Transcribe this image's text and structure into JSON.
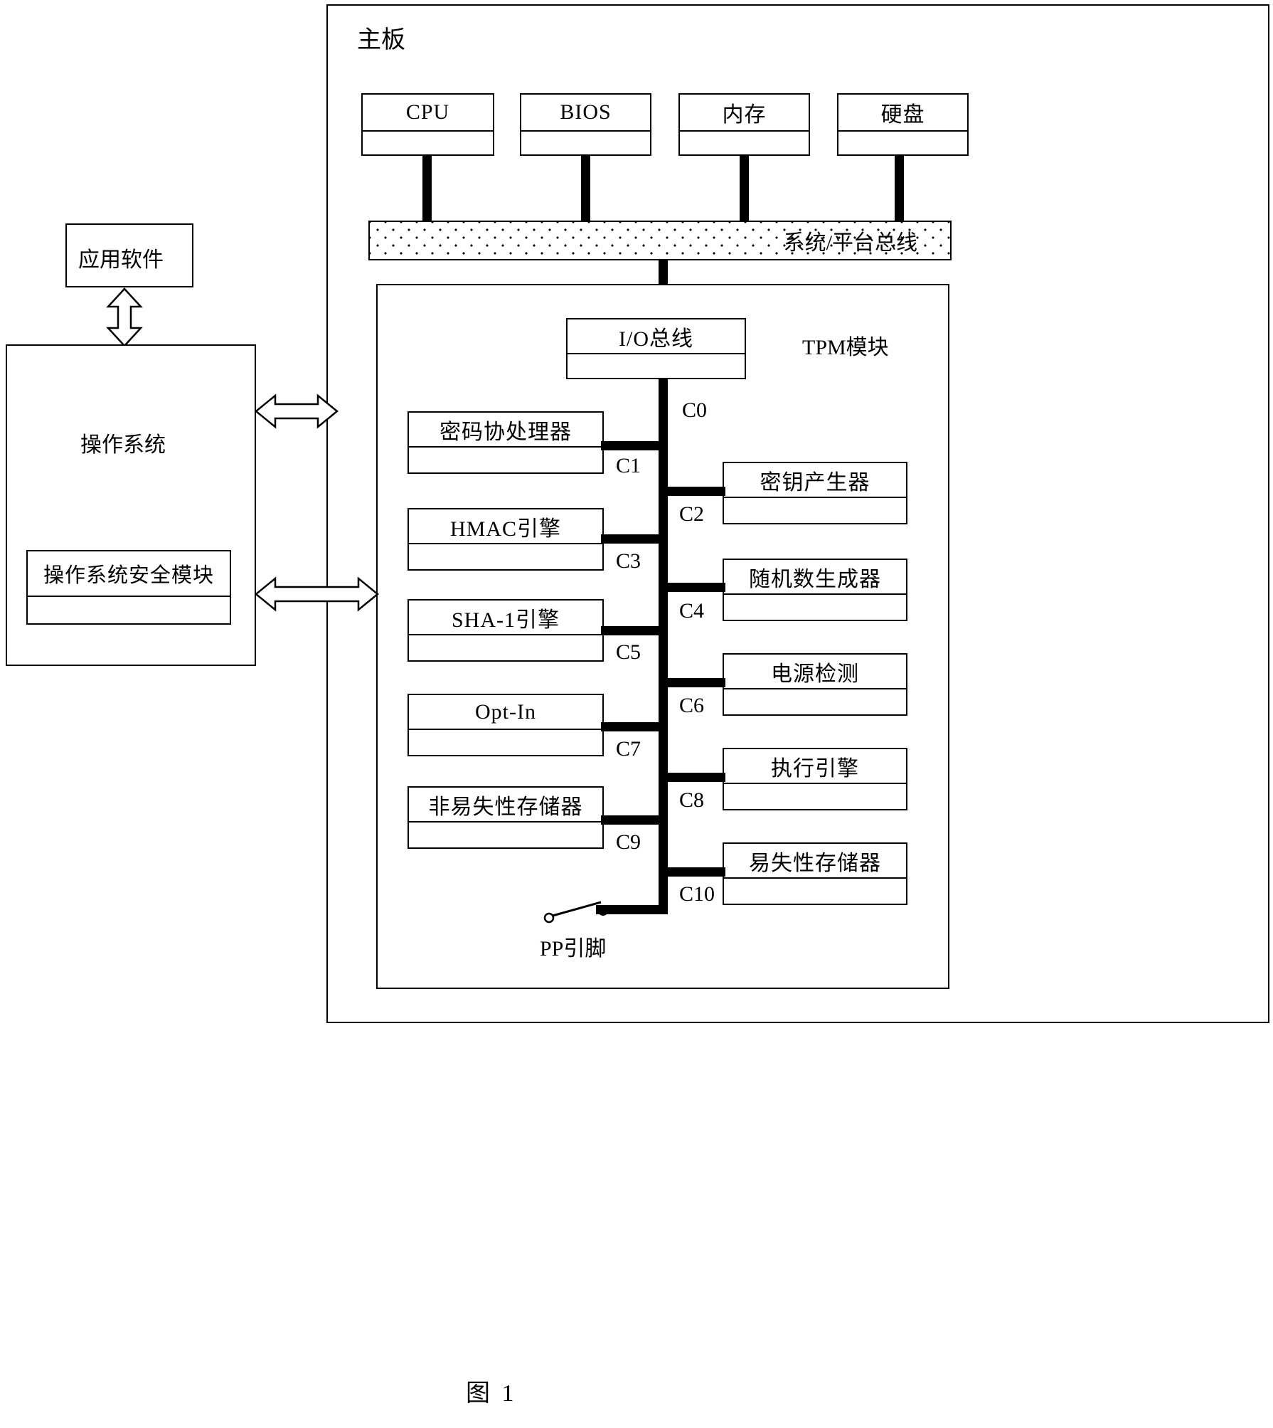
{
  "figure": {
    "caption": "图 1"
  },
  "motherboard": {
    "label": "主板"
  },
  "top_components": [
    {
      "label": "CPU"
    },
    {
      "label": "BIOS"
    },
    {
      "label": "内存"
    },
    {
      "label": "硬盘"
    }
  ],
  "system_bus": {
    "label": "系统/平台总线"
  },
  "tpm": {
    "label": "TPM模块",
    "io_bus": {
      "label": "I/O总线"
    },
    "left_modules": [
      {
        "label": "密码协处理器",
        "connector": "C1"
      },
      {
        "label": "HMAC引擎",
        "connector": "C3"
      },
      {
        "label": "SHA-1引擎",
        "connector": "C5"
      },
      {
        "label": "Opt-In",
        "connector": "C7"
      },
      {
        "label": "非易失性存储器",
        "connector": "C9"
      }
    ],
    "right_modules": [
      {
        "label": "密钥产生器",
        "connector": "C2"
      },
      {
        "label": "随机数生成器",
        "connector": "C4"
      },
      {
        "label": "电源检测",
        "connector": "C6"
      },
      {
        "label": "执行引擎",
        "connector": "C8"
      },
      {
        "label": "易失性存储器",
        "connector": "C10"
      }
    ],
    "trunk_connector": "C0",
    "pp_pin": {
      "label": "PP引脚"
    }
  },
  "software_stack": {
    "application": {
      "label": "应用软件"
    },
    "os": {
      "label": "操作系统"
    },
    "os_security": {
      "label": "操作系统安全模块"
    }
  }
}
